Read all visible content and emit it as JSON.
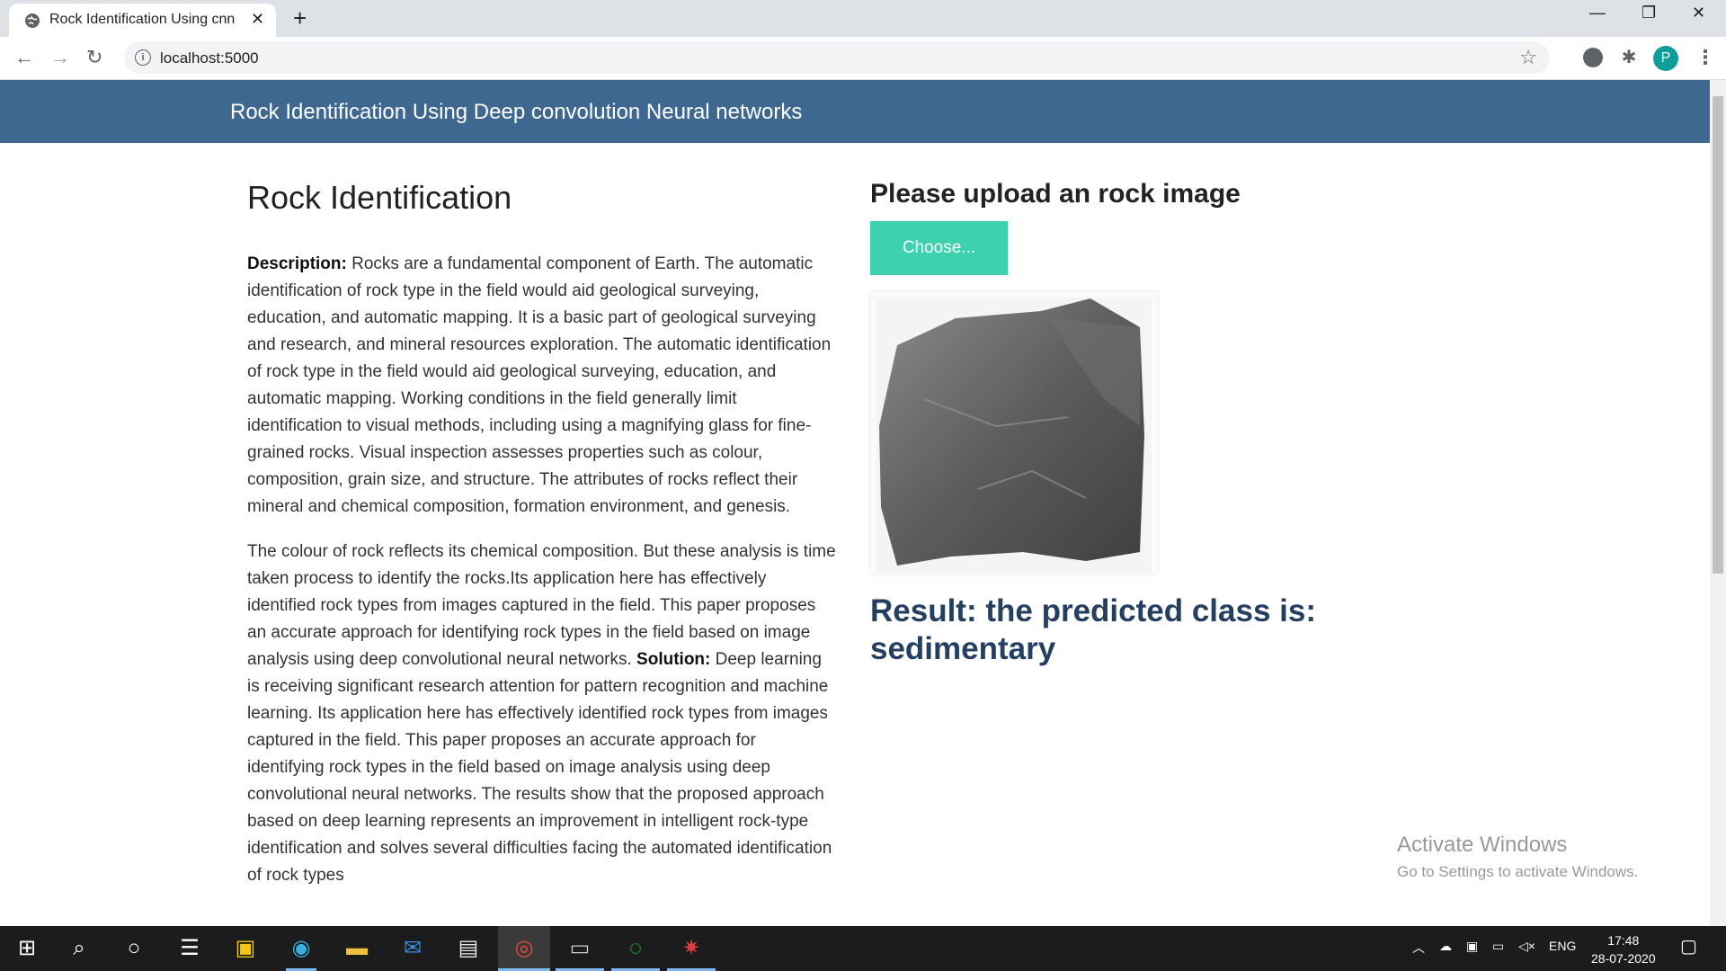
{
  "browser": {
    "tab_title": "Rock Identification Using cnn",
    "url": "localhost:5000"
  },
  "page": {
    "brand": "Rock Identification Using Deep convolution Neural networks",
    "title": "Rock Identification",
    "description_label": "Description:",
    "description_text": " Rocks are a fundamental component of Earth. The automatic identification of rock type in the field would aid geological surveying, education, and automatic mapping. It is a basic part of geological surveying and research, and mineral resources exploration. The automatic identification of rock type in the field would aid geological surveying, education, and automatic mapping. Working conditions in the field generally limit identification to visual methods, including using a magnifying glass for fine-grained rocks. Visual inspection assesses properties such as colour, composition, grain size, and structure. The attributes of rocks reflect their mineral and chemical composition, formation environment, and genesis.",
    "para2": "The colour of rock reflects its chemical composition. But these analysis is time taken process to identify the rocks.Its application here has effectively identified rock types from images captured in the field. This paper proposes an accurate approach for identifying rock types in the field based on image analysis using deep convolutional neural networks.",
    "solution_label": "Solution:",
    "solution_text": " Deep learning is receiving significant research attention for pattern recognition and machine learning. Its application here has effectively identified rock types from images captured in the field. This paper proposes an accurate approach for identifying rock types in the field based on image analysis using deep convolutional neural networks. The results show that the proposed approach based on deep learning represents an improvement in intelligent rock-type identification and solves several difficulties facing the automated identification of rock types",
    "upload_title": "Please upload an rock image",
    "choose_label": "Choose...",
    "result_text": "Result: the predicted class is: sedimentary"
  },
  "watermark": {
    "line1": "Activate Windows",
    "line2": "Go to Settings to activate Windows."
  },
  "taskbar": {
    "lang": "ENG",
    "time": "17:48",
    "date": "28-07-2020"
  },
  "colors": {
    "navbar": "#3f6890",
    "choose_button": "#3ed1b0",
    "result": "#243f60"
  }
}
